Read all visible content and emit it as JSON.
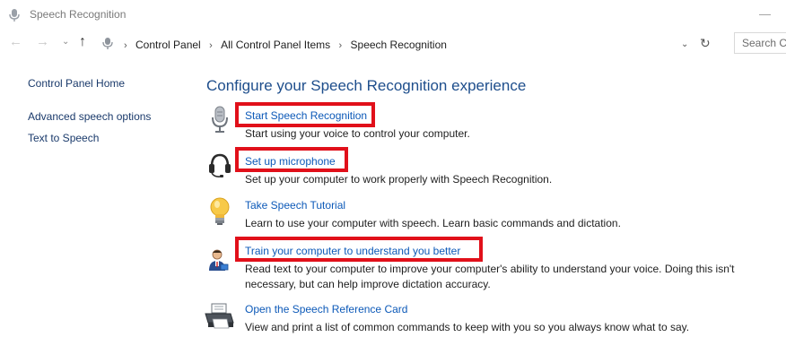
{
  "window": {
    "title": "Speech Recognition",
    "minimize_glyph": "—"
  },
  "nav": {
    "back_icon": "back-arrow-icon",
    "forward_icon": "forward-arrow-icon",
    "up_icon": "up-arrow-icon",
    "back_glyph": "←",
    "forward_glyph": "→",
    "dropdown_glyph": "⌄",
    "up_glyph": "↑",
    "separator_glyph": "›",
    "refresh_glyph": "↻",
    "breadcrumbs": [
      "Control Panel",
      "All Control Panel Items",
      "Speech Recognition"
    ],
    "search_placeholder": "Search C"
  },
  "sidebar": {
    "home": "Control Panel Home",
    "links": [
      "Advanced speech options",
      "Text to Speech"
    ]
  },
  "main": {
    "heading": "Configure your Speech Recognition experience",
    "tasks": [
      {
        "title": "Start Speech Recognition",
        "desc": "Start using your voice to control your computer.",
        "icon": "microphone-icon",
        "highlighted": true
      },
      {
        "title": "Set up microphone",
        "desc": "Set up your computer to work properly with Speech Recognition.",
        "icon": "headset-icon",
        "highlighted": true
      },
      {
        "title": "Take Speech Tutorial",
        "desc": "Learn to use your computer with speech. Learn basic commands and dictation.",
        "icon": "lightbulb-icon",
        "highlighted": false
      },
      {
        "title": "Train your computer to understand you better",
        "desc": "Read text to your computer to improve your computer's ability to understand your voice. Doing this isn't necessary, but can help improve dictation accuracy.",
        "icon": "user-train-icon",
        "highlighted": true
      },
      {
        "title": "Open the Speech Reference Card",
        "desc": "View and print a list of common commands to keep with you so you always know what to say.",
        "icon": "printer-icon",
        "highlighted": false
      }
    ]
  },
  "colors": {
    "highlight": "#e1101a",
    "link": "#0c59b8",
    "heading": "#1e4e8c"
  }
}
